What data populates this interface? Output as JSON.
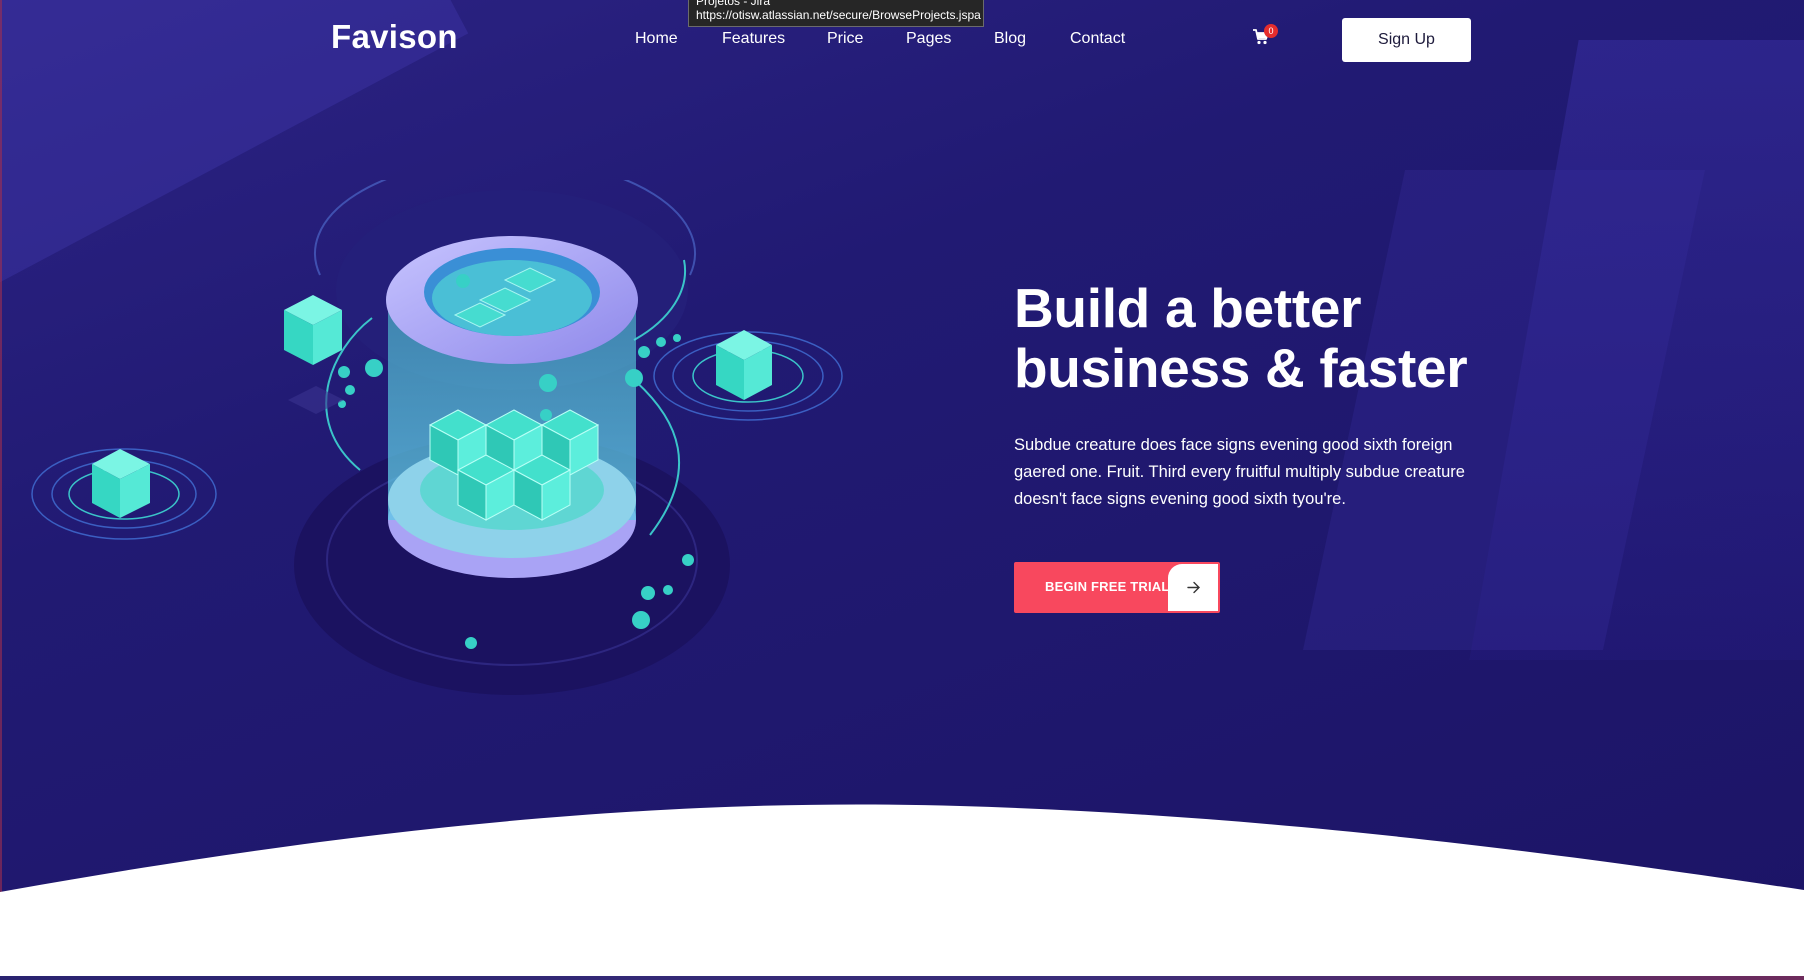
{
  "brand": {
    "logo_text": "Favison"
  },
  "nav": {
    "items": [
      {
        "label": "Home"
      },
      {
        "label": "Features"
      },
      {
        "label": "Price"
      },
      {
        "label": "Pages"
      },
      {
        "label": "Blog"
      },
      {
        "label": "Contact"
      }
    ]
  },
  "cart": {
    "icon": "shopping-cart-icon",
    "count": "0"
  },
  "header": {
    "signup_label": "Sign Up"
  },
  "tooltip": {
    "title": "Projetos - Jira",
    "url": "https://otisw.atlassian.net/secure/BrowseProjects.jspa"
  },
  "hero": {
    "headline_line1": "Build a better",
    "headline_line2": "business & faster",
    "description": "Subdue creature does face signs evening good sixth foreign gaered one. Fruit. Third every fruitful multiply subdue creature doesn't face signs evening good sixth tyou're.",
    "cta_label": "BEGIN FREE TRIAL",
    "cta_icon": "arrow-right-icon"
  },
  "colors": {
    "background": "#211a73",
    "accent": "#f8485e",
    "illustration_cyan": "#4ee8d6",
    "badge": "#e52d2d"
  }
}
